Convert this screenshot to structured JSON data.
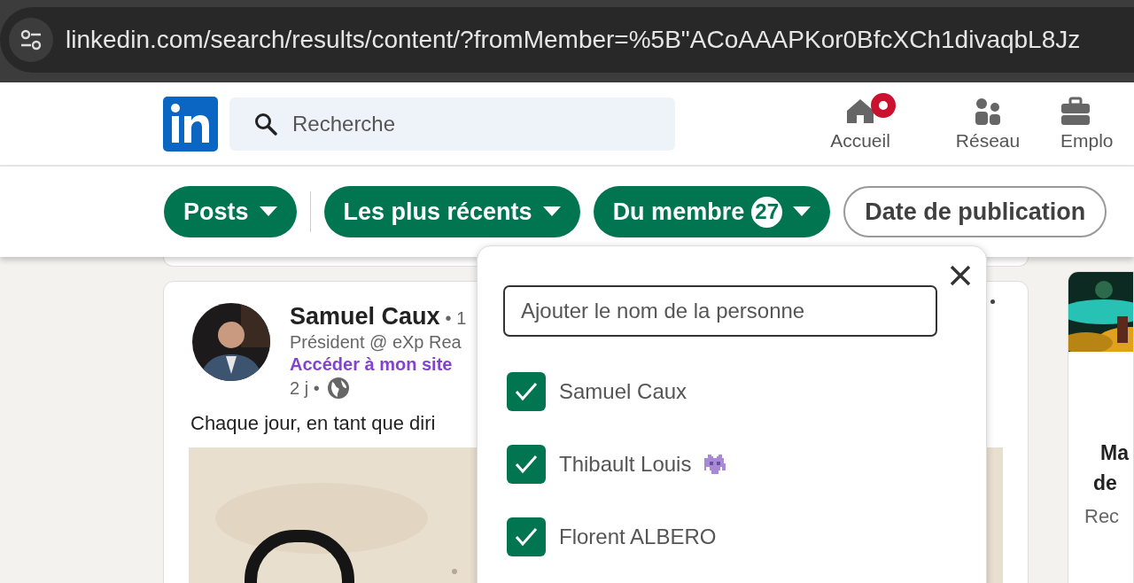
{
  "browser": {
    "url": "linkedin.com/search/results/content/?fromMember=%5B\"ACoAAAPKor0BfcXCh1divaqbL8Jz"
  },
  "header": {
    "search": {
      "placeholder": "Recherche"
    },
    "nav": [
      {
        "label": "Accueil",
        "kind": "home",
        "notification": true
      },
      {
        "label": "Réseau",
        "kind": "network",
        "notification": false
      },
      {
        "label": "Emplo",
        "kind": "jobs",
        "notification": false
      }
    ]
  },
  "filters": [
    {
      "label": "Posts",
      "selected": true
    },
    {
      "label": "Les plus récents",
      "selected": true
    },
    {
      "label": "Du membre",
      "selected": true,
      "count": "27"
    },
    {
      "label": "Date de publication",
      "selected": false
    }
  ],
  "post": {
    "author": "Samuel Caux",
    "degree": "• 1",
    "headline": "Président @ eXp Rea",
    "link": "Accéder à mon site",
    "time": "2 j •",
    "text": "Chaque jour, en tant que diri"
  },
  "side_card": {
    "title_lines": [
      "Ma",
      "de"
    ],
    "subtitle": "Rec"
  },
  "member_dropdown": {
    "search": {
      "placeholder": "Ajouter le nom de la personne"
    },
    "members": [
      {
        "name": "Samuel Caux",
        "checked": true,
        "emoji_icon": false
      },
      {
        "name": "Thibault Louis",
        "checked": true,
        "emoji_icon": true
      },
      {
        "name": "Florent ALBERO",
        "checked": true,
        "emoji_icon": false
      }
    ]
  }
}
